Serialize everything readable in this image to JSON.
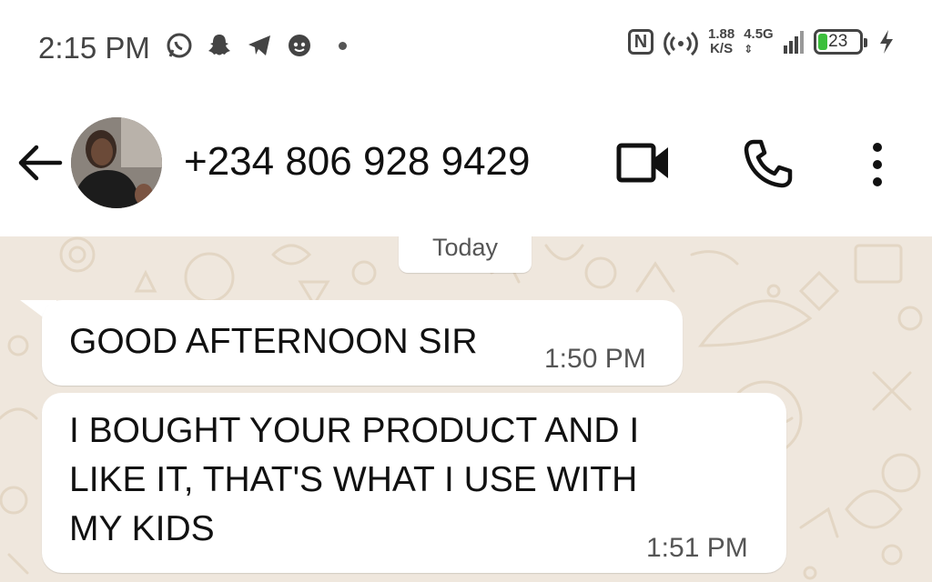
{
  "status_bar": {
    "time": "2:15 PM",
    "notification_icons": [
      "whatsapp-icon",
      "snapchat-icon",
      "telegram-icon",
      "face-app-icon"
    ],
    "nfc_label": "N",
    "net_speed": "1.88",
    "net_speed_unit": "K/S",
    "network_type": "4.5G",
    "battery_level": "23"
  },
  "header": {
    "contact_name": "+234 806 928 9429"
  },
  "chat": {
    "date_label": "Today",
    "messages": [
      {
        "text": "GOOD AFTERNOON SIR",
        "time": "1:50 PM"
      },
      {
        "lines": [
          "I BOUGHT YOUR PRODUCT AND I",
          "LIKE IT, THAT'S WHAT I USE WITH",
          "MY KIDS"
        ],
        "time": "1:51 PM"
      }
    ]
  },
  "colors": {
    "chat_background": "#efe7dd",
    "bubble": "#ffffff",
    "battery_fill": "#3cbf3c"
  }
}
